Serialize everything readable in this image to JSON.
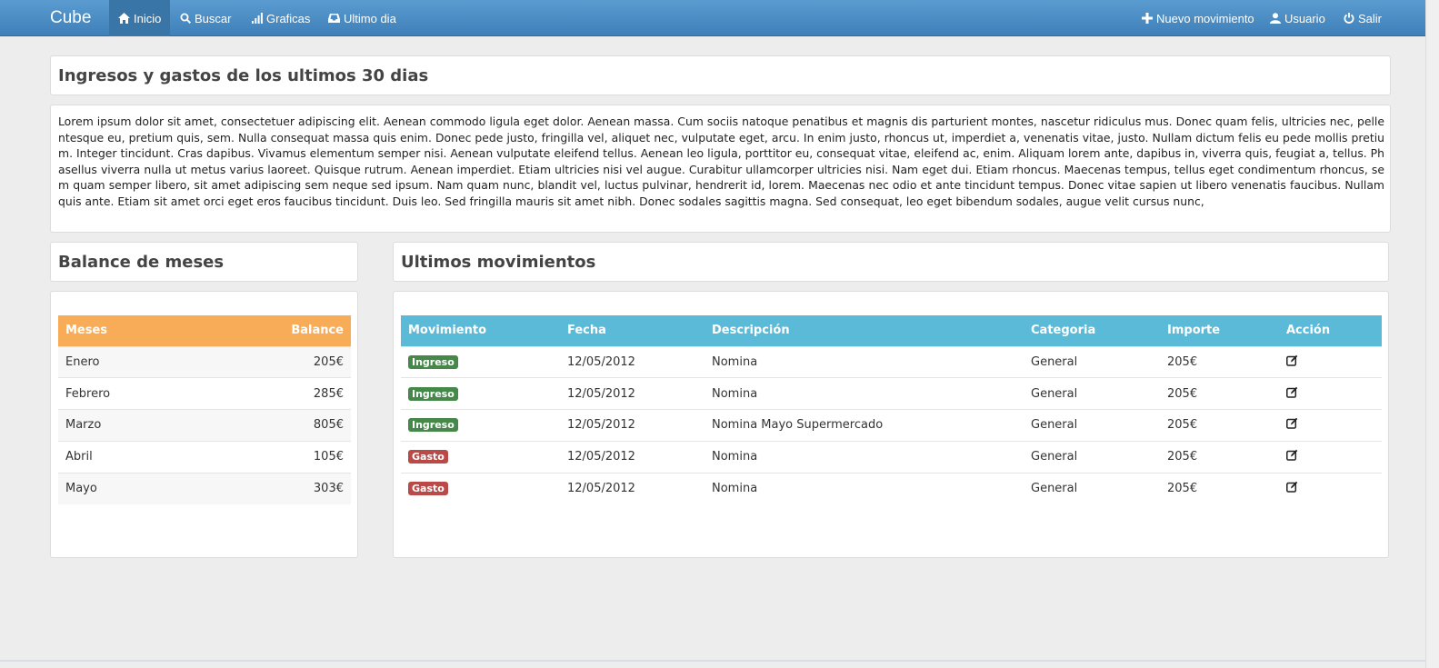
{
  "nav": {
    "brand": "Cube",
    "left": [
      {
        "label": "Inicio",
        "icon": "home-icon"
      },
      {
        "label": "Buscar",
        "icon": "search-icon"
      },
      {
        "label": "Graficas",
        "icon": "signal-icon"
      },
      {
        "label": "Ultimo dia",
        "icon": "inbox-icon"
      }
    ],
    "right": [
      {
        "label": "Nuevo movimiento",
        "icon": "plus-icon"
      },
      {
        "label": "Usuario",
        "icon": "user-icon"
      },
      {
        "label": "Salir",
        "icon": "power-icon"
      }
    ]
  },
  "summary": {
    "title": "Ingresos y gastos de los ultimos 30 dias",
    "text": "Lorem ipsum dolor sit amet, consectetuer adipiscing elit. Aenean commodo ligula eget dolor. Aenean massa. Cum sociis natoque penatibus et magnis dis parturient montes, nascetur ridiculus mus. Donec quam felis, ultricies nec, pellentesque eu, pretium quis, sem. Nulla consequat massa quis enim. Donec pede justo, fringilla vel, aliquet nec, vulputate eget, arcu. In enim justo, rhoncus ut, imperdiet a, venenatis vitae, justo. Nullam dictum felis eu pede mollis pretium. Integer tincidunt. Cras dapibus. Vivamus elementum semper nisi. Aenean vulputate eleifend tellus. Aenean leo ligula, porttitor eu, consequat vitae, eleifend ac, enim. Aliquam lorem ante, dapibus in, viverra quis, feugiat a, tellus. Phasellus viverra nulla ut metus varius laoreet. Quisque rutrum. Aenean imperdiet. Etiam ultricies nisi vel augue. Curabitur ullamcorper ultricies nisi. Nam eget dui. Etiam rhoncus. Maecenas tempus, tellus eget condimentum rhoncus, sem quam semper libero, sit amet adipiscing sem neque sed ipsum. Nam quam nunc, blandit vel, luctus pulvinar, hendrerit id, lorem. Maecenas nec odio et ante tincidunt tempus. Donec vitae sapien ut libero venenatis faucibus. Nullam quis ante. Etiam sit amet orci eget eros faucibus tincidunt. Duis leo. Sed fringilla mauris sit amet nibh. Donec sodales sagittis magna. Sed consequat, leo eget bibendum sodales, augue velit cursus nunc,"
  },
  "balance": {
    "title": "Balance de meses",
    "headers": {
      "month": "Meses",
      "balance": "Balance"
    },
    "header_color": "#f9ac58",
    "rows": [
      {
        "month": "Enero",
        "balance": "205€"
      },
      {
        "month": "Febrero",
        "balance": "285€"
      },
      {
        "month": "Marzo",
        "balance": "805€"
      },
      {
        "month": "Abril",
        "balance": "105€"
      },
      {
        "month": "Mayo",
        "balance": "303€"
      }
    ]
  },
  "movements": {
    "title": "Ultimos movimientos",
    "header_color": "#5bbad8",
    "headers": [
      "Movimiento",
      "Fecha",
      "Descripción",
      "Categoria",
      "Importe",
      "Acción"
    ],
    "rows": [
      {
        "type": "Ingreso",
        "date": "12/05/2012",
        "description": "Nomina",
        "category": "General",
        "amount": "205€"
      },
      {
        "type": "Ingreso",
        "date": "12/05/2012",
        "description": "Nomina",
        "category": "General",
        "amount": "205€"
      },
      {
        "type": "Ingreso",
        "date": "12/05/2012",
        "description": "Nomina Mayo Supermercado",
        "category": "General",
        "amount": "205€"
      },
      {
        "type": "Gasto",
        "date": "12/05/2012",
        "description": "Nomina",
        "category": "General",
        "amount": "205€"
      },
      {
        "type": "Gasto",
        "date": "12/05/2012",
        "description": "Nomina",
        "category": "General",
        "amount": "205€"
      }
    ],
    "badge_colors": {
      "Ingreso": "#46874a",
      "Gasto": "#b94a48"
    }
  }
}
